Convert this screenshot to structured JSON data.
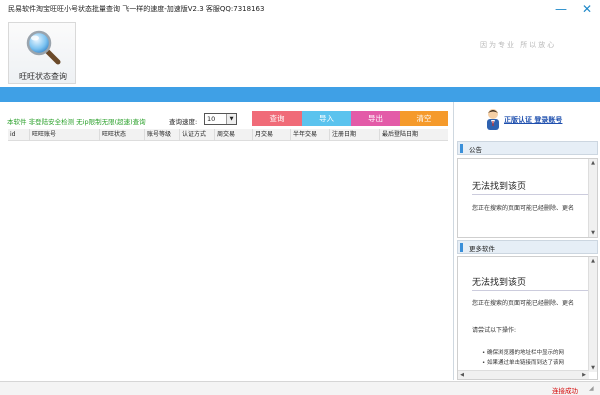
{
  "window": {
    "title": "民易软件淘宝旺旺小号状态批量查询   飞一样的速度-加速版V2.3   客服QQ:7318163",
    "minimize_symbol": "—",
    "close_symbol": "✕"
  },
  "toolbar": {
    "status_query_label": "旺旺状态查询",
    "slogan": "因为专业 所以放心"
  },
  "controls": {
    "notice": "本软件  非登陆安全检测 无ip限制无限(超速)查询",
    "speed_label": "查询速度:",
    "speed_value": "10",
    "buttons": {
      "query": "查询",
      "import": "导入",
      "export": "导出",
      "clear": "清空"
    }
  },
  "table": {
    "columns": [
      "id",
      "旺旺账号",
      "旺旺状态",
      "账号等级",
      "认证方式",
      "周交易",
      "月交易",
      "半年交易",
      "注册日期",
      "最后登陆日期"
    ]
  },
  "right_panel": {
    "login_link": "正版认证 登录账号",
    "announcement_title": "公告",
    "more_software_title": "更多软件",
    "page_error": {
      "title": "无法找到该页",
      "description": "您正在搜索的页面可能已经删除、更名",
      "try_heading": "请尝试以下操作:",
      "bullets": [
        "确保浏览器的地址栏中显示的网",
        "如果通过单击链接而到达了该网"
      ]
    }
  },
  "statusbar": {
    "status": "连接成功"
  },
  "colors": {
    "accent_blue": "#3fa0e6",
    "query_button": "#f06b78",
    "import_button": "#5bc3ee",
    "export_button": "#e35ba8",
    "clear_button": "#f59a2b",
    "notice_text": "#2aa02a",
    "status_text": "#d40000"
  }
}
